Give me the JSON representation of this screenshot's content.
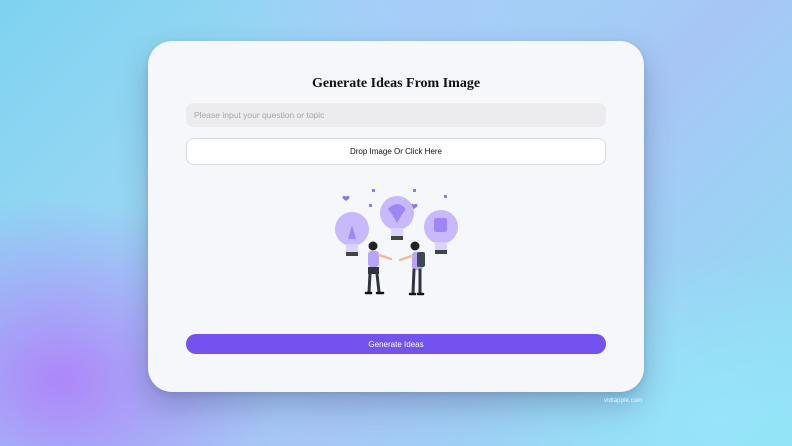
{
  "card": {
    "title": "Generate Ideas From Image",
    "question_input": {
      "placeholder": "Please input your question or topic",
      "value": ""
    },
    "drop_zone_label": "Drop Image Or Click Here",
    "illustration": "ideas-lightbulbs-people-illustration",
    "generate_button_label": "Generate Ideas"
  },
  "watermark": "vidtapple.com",
  "colors": {
    "accent": "#7452f0",
    "card_bg": "#f6f7fa",
    "bulb": "#c7b9fb"
  }
}
